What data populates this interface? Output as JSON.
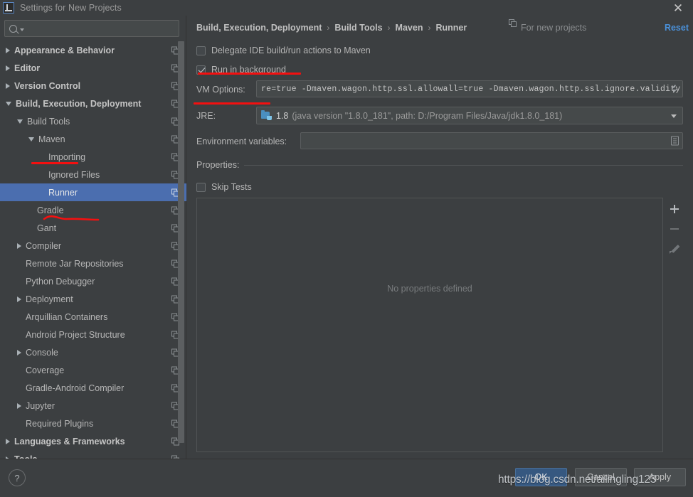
{
  "window": {
    "title": "Settings for New Projects",
    "app_icon": "intellij-idea-icon",
    "close_label": "✕"
  },
  "search": {
    "value": "",
    "placeholder": "",
    "icon": "search-icon"
  },
  "sidebar": {
    "items": [
      {
        "label": "Appearance & Behavior",
        "depth": 0,
        "arrow": "collapsed",
        "bold": true,
        "selected": false
      },
      {
        "label": "Editor",
        "depth": 0,
        "arrow": "collapsed",
        "bold": true,
        "selected": false
      },
      {
        "label": "Version Control",
        "depth": 0,
        "arrow": "collapsed",
        "bold": true,
        "selected": false
      },
      {
        "label": "Build, Execution, Deployment",
        "depth": 0,
        "arrow": "expanded",
        "bold": true,
        "selected": false
      },
      {
        "label": "Build Tools",
        "depth": 1,
        "arrow": "expanded",
        "bold": false,
        "selected": false
      },
      {
        "label": "Maven",
        "depth": 2,
        "arrow": "expanded",
        "bold": false,
        "selected": false
      },
      {
        "label": "Importing",
        "depth": 3,
        "arrow": "none",
        "bold": false,
        "selected": false
      },
      {
        "label": "Ignored Files",
        "depth": 3,
        "arrow": "none",
        "bold": false,
        "selected": false
      },
      {
        "label": "Runner",
        "depth": 3,
        "arrow": "none",
        "bold": false,
        "selected": true
      },
      {
        "label": "Gradle",
        "depth": 2,
        "arrow": "none",
        "bold": false,
        "selected": false
      },
      {
        "label": "Gant",
        "depth": 2,
        "arrow": "none",
        "bold": false,
        "selected": false
      },
      {
        "label": "Compiler",
        "depth": 1,
        "arrow": "collapsed",
        "bold": false,
        "selected": false
      },
      {
        "label": "Remote Jar Repositories",
        "depth": 1,
        "arrow": "none",
        "bold": false,
        "selected": false
      },
      {
        "label": "Python Debugger",
        "depth": 1,
        "arrow": "none",
        "bold": false,
        "selected": false
      },
      {
        "label": "Deployment",
        "depth": 1,
        "arrow": "collapsed",
        "bold": false,
        "selected": false
      },
      {
        "label": "Arquillian Containers",
        "depth": 1,
        "arrow": "none",
        "bold": false,
        "selected": false
      },
      {
        "label": "Android Project Structure",
        "depth": 1,
        "arrow": "none",
        "bold": false,
        "selected": false
      },
      {
        "label": "Console",
        "depth": 1,
        "arrow": "collapsed",
        "bold": false,
        "selected": false
      },
      {
        "label": "Coverage",
        "depth": 1,
        "arrow": "none",
        "bold": false,
        "selected": false
      },
      {
        "label": "Gradle-Android Compiler",
        "depth": 1,
        "arrow": "none",
        "bold": false,
        "selected": false
      },
      {
        "label": "Jupyter",
        "depth": 1,
        "arrow": "collapsed",
        "bold": false,
        "selected": false
      },
      {
        "label": "Required Plugins",
        "depth": 1,
        "arrow": "none",
        "bold": false,
        "selected": false
      },
      {
        "label": "Languages & Frameworks",
        "depth": 0,
        "arrow": "collapsed",
        "bold": true,
        "selected": false
      },
      {
        "label": "Tools",
        "depth": 0,
        "arrow": "collapsed",
        "bold": true,
        "selected": false
      }
    ]
  },
  "header": {
    "breadcrumb": [
      "Build, Execution, Deployment",
      "Build Tools",
      "Maven",
      "Runner"
    ],
    "separator": "›",
    "scope_note": "For new projects",
    "scope_icon": "copy-icon",
    "reset_label": "Reset"
  },
  "form": {
    "delegate": {
      "label": "Delegate IDE build/run actions to Maven",
      "checked": false
    },
    "run_in_background": {
      "label": "Run in background",
      "checked": true
    },
    "vm_options": {
      "label": "VM Options:",
      "value": "re=true -Dmaven.wagon.http.ssl.allowall=true -Dmaven.wagon.http.ssl.ignore.validity.dates=true",
      "expand_icon": "expand-icon"
    },
    "jre": {
      "label": "JRE:",
      "icon": "java-folder-icon",
      "value_main": "1.8",
      "value_detail": "(java version \"1.8.0_181\", path: D:/Program Files/Java/jdk1.8.0_181)",
      "caret_icon": "chevron-down-icon"
    },
    "environment_variables": {
      "label": "Environment variables:",
      "value": "",
      "icon": "list-editor-icon"
    },
    "properties_section": {
      "label": "Properties:",
      "skip_tests": {
        "label": "Skip Tests",
        "checked": false
      },
      "empty_text": "No properties defined",
      "toolbar": [
        {
          "name": "add-property-button",
          "icon": "plus-icon",
          "enabled": true
        },
        {
          "name": "remove-property-button",
          "icon": "minus-icon",
          "enabled": false
        },
        {
          "name": "edit-property-button",
          "icon": "pencil-icon",
          "enabled": false
        }
      ]
    }
  },
  "footer": {
    "help_label": "?",
    "ok_label": "OK",
    "cancel_label": "Cancel",
    "apply_label": "Apply"
  },
  "watermark": {
    "text": "https://blog.csdn.net/ailingling123"
  },
  "colors": {
    "background": "#3c3f41",
    "selection": "#4b6eaf",
    "primary_button": "#365880",
    "link": "#4a90d9",
    "annotation_red": "#f41010",
    "field_background": "#45494a"
  }
}
